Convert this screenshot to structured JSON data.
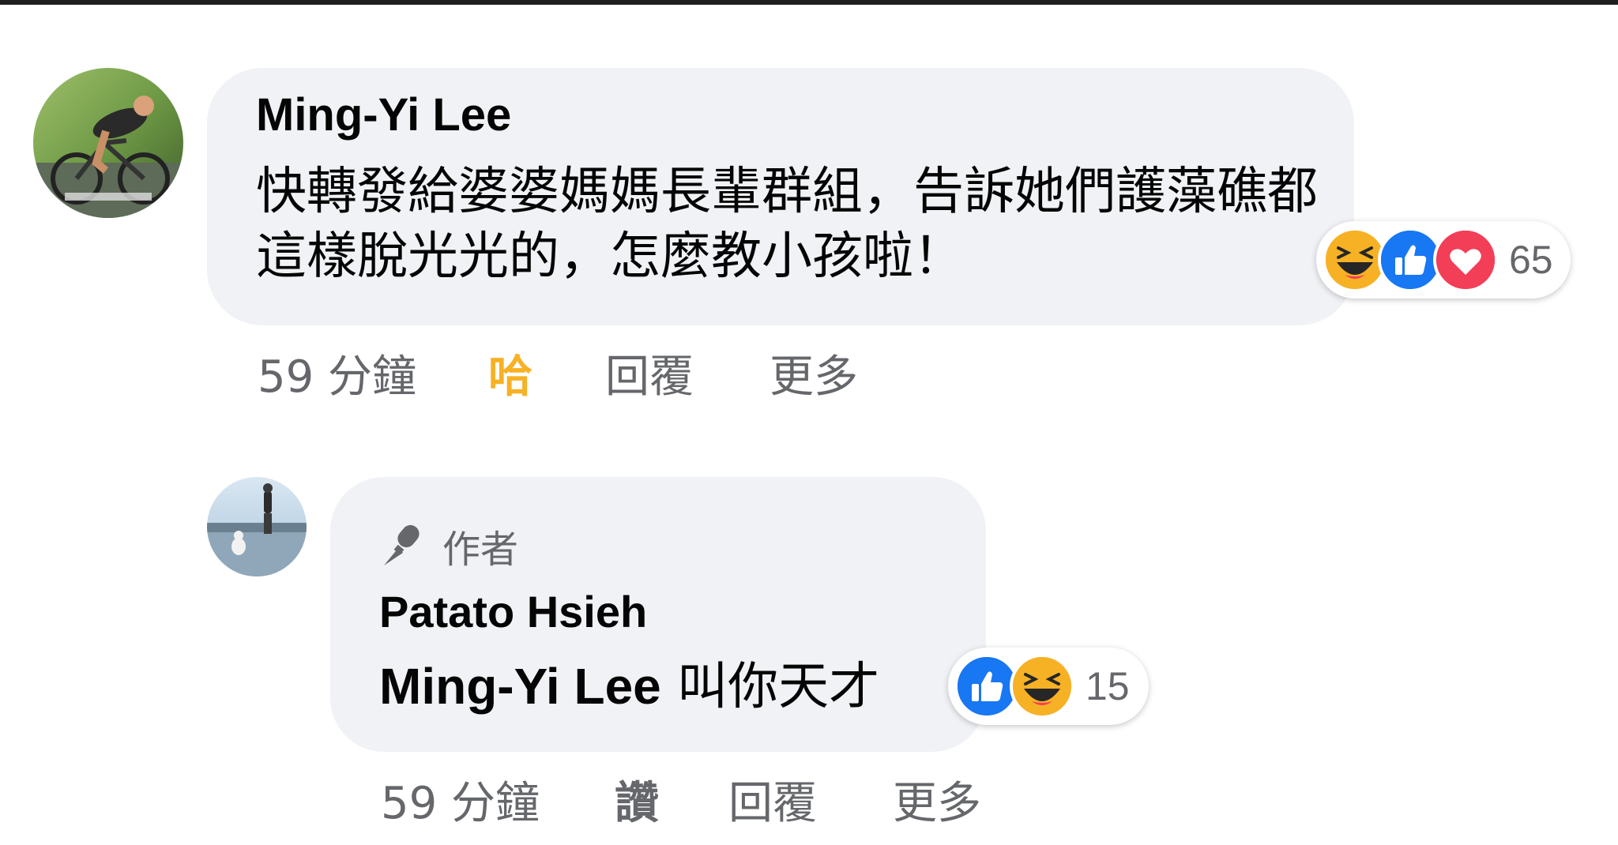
{
  "comment": {
    "author": "Ming-Yi Lee",
    "text": "快轉發給婆婆媽媽長輩群組，告訴她們護藻礁都這樣脫光光的，怎麼教小孩啦！",
    "avatar_icon": "cyclist-avatar",
    "reactions": {
      "icons": [
        "haha-icon",
        "like-icon",
        "love-icon"
      ],
      "count": "65"
    },
    "actions": {
      "time": "59 分鐘",
      "react": "哈",
      "react_color": "#f7b125",
      "reply": "回覆",
      "more": "更多"
    }
  },
  "reply": {
    "badge": "作者",
    "badge_icon": "microphone-icon",
    "author": "Patato Hsieh",
    "mention": "Ming-Yi Lee",
    "text": "叫你天才",
    "avatar_icon": "beach-avatar",
    "reactions": {
      "icons": [
        "like-icon",
        "haha-icon"
      ],
      "count": "15"
    },
    "actions": {
      "time": "59 分鐘",
      "react": "讚",
      "reply": "回覆",
      "more": "更多"
    }
  },
  "colors": {
    "bubble": "#f0f2f5",
    "secondary_text": "#65676b",
    "like_blue": "#1877f2",
    "love_red": "#f33e58",
    "haha_yellow": "#f7b125"
  }
}
